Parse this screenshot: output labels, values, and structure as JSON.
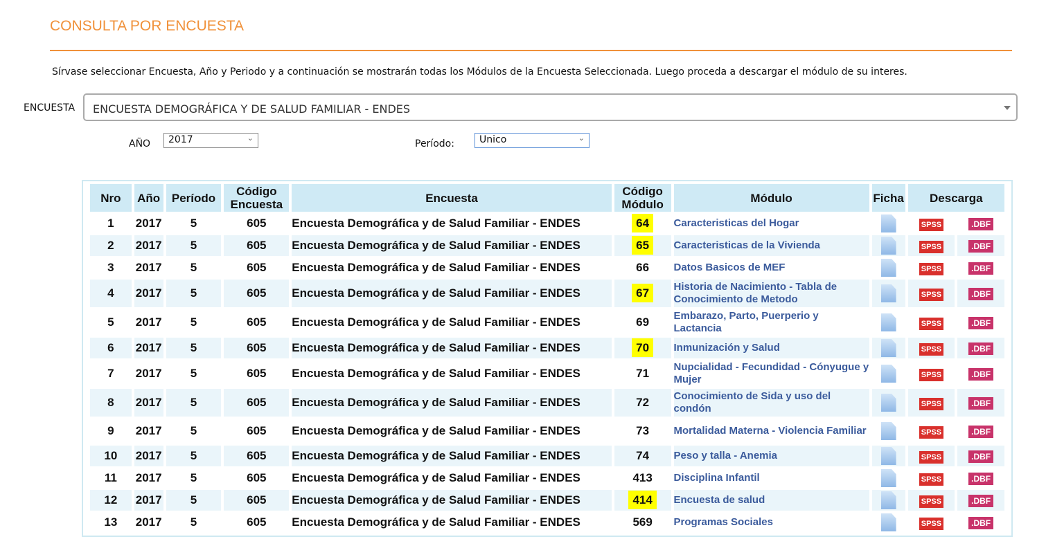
{
  "title": "CONSULTA POR ENCUESTA",
  "instructions": "Sírvase seleccionar Encuesta, Año y Periodo y a continuación se mostrarán todas los Módulos de la Encuesta Seleccionada. Luego proceda a descargar el módulo de su interes.",
  "filters": {
    "encuesta_label": "ENCUESTA",
    "encuesta_value": "ENCUESTA DEMOGRÁFICA Y DE SALUD FAMILIAR - ENDES",
    "anio_label": "AÑO",
    "anio_value": "2017",
    "periodo_label": "Período:",
    "periodo_value": "Unico"
  },
  "table": {
    "headers": [
      "Nro",
      "Año",
      "Período",
      "Código Encuesta",
      "Encuesta",
      "Código Módulo",
      "Módulo",
      "Ficha",
      "Descarga"
    ],
    "spss_label": "SPSS",
    "dbf_label": ".DBF",
    "highlight_color": "#ffff00",
    "rows": [
      {
        "nro": "1",
        "anio": "2017",
        "periodo": "5",
        "cod_enc": "605",
        "encuesta": "Encuesta Demográfica y de Salud Familiar - ENDES",
        "cod_mod": "64",
        "modulo": "Caracteristicas del Hogar",
        "hl": true
      },
      {
        "nro": "2",
        "anio": "2017",
        "periodo": "5",
        "cod_enc": "605",
        "encuesta": "Encuesta Demográfica y de Salud Familiar - ENDES",
        "cod_mod": "65",
        "modulo": "Caracteristicas de la Vivienda",
        "hl": true
      },
      {
        "nro": "3",
        "anio": "2017",
        "periodo": "5",
        "cod_enc": "605",
        "encuesta": "Encuesta Demográfica y de Salud Familiar - ENDES",
        "cod_mod": "66",
        "modulo": "Datos Basicos de MEF",
        "hl": false
      },
      {
        "nro": "4",
        "anio": "2017",
        "periodo": "5",
        "cod_enc": "605",
        "encuesta": "Encuesta Demográfica y de Salud Familiar - ENDES",
        "cod_mod": "67",
        "modulo": "Historia de Nacimiento - Tabla de Conocimiento de Metodo",
        "hl": true
      },
      {
        "nro": "5",
        "anio": "2017",
        "periodo": "5",
        "cod_enc": "605",
        "encuesta": "Encuesta Demográfica y de Salud Familiar - ENDES",
        "cod_mod": "69",
        "modulo": "Embarazo, Parto, Puerperio y Lactancia",
        "hl": false
      },
      {
        "nro": "6",
        "anio": "2017",
        "periodo": "5",
        "cod_enc": "605",
        "encuesta": "Encuesta Demográfica y de Salud Familiar - ENDES",
        "cod_mod": "70",
        "modulo": "Inmunización y Salud",
        "hl": true
      },
      {
        "nro": "7",
        "anio": "2017",
        "periodo": "5",
        "cod_enc": "605",
        "encuesta": "Encuesta Demográfica y de Salud Familiar - ENDES",
        "cod_mod": "71",
        "modulo": "Nupcialidad - Fecundidad - Cónyugue y Mujer",
        "hl": false
      },
      {
        "nro": "8",
        "anio": "2017",
        "periodo": "5",
        "cod_enc": "605",
        "encuesta": "Encuesta Demográfica y de Salud Familiar - ENDES",
        "cod_mod": "72",
        "modulo": "Conocimiento de Sida y uso del condón",
        "hl": false
      },
      {
        "nro": "9",
        "anio": "2017",
        "periodo": "5",
        "cod_enc": "605",
        "encuesta": "Encuesta Demográfica y de Salud Familiar - ENDES",
        "cod_mod": "73",
        "modulo": "Mortalidad Materna - Violencia Familiar",
        "hl": false
      },
      {
        "nro": "10",
        "anio": "2017",
        "periodo": "5",
        "cod_enc": "605",
        "encuesta": "Encuesta Demográfica y de Salud Familiar - ENDES",
        "cod_mod": "74",
        "modulo": "Peso y talla - Anemia",
        "hl": false
      },
      {
        "nro": "11",
        "anio": "2017",
        "periodo": "5",
        "cod_enc": "605",
        "encuesta": "Encuesta Demográfica y de Salud Familiar - ENDES",
        "cod_mod": "413",
        "modulo": "Disciplina Infantil",
        "hl": false
      },
      {
        "nro": "12",
        "anio": "2017",
        "periodo": "5",
        "cod_enc": "605",
        "encuesta": "Encuesta Demográfica y de Salud Familiar - ENDES",
        "cod_mod": "414",
        "modulo": "Encuesta de salud",
        "hl": true
      },
      {
        "nro": "13",
        "anio": "2017",
        "periodo": "5",
        "cod_enc": "605",
        "encuesta": "Encuesta Demográfica y de Salud Familiar - ENDES",
        "cod_mod": "569",
        "modulo": "Programas Sociales",
        "hl": false
      }
    ]
  }
}
